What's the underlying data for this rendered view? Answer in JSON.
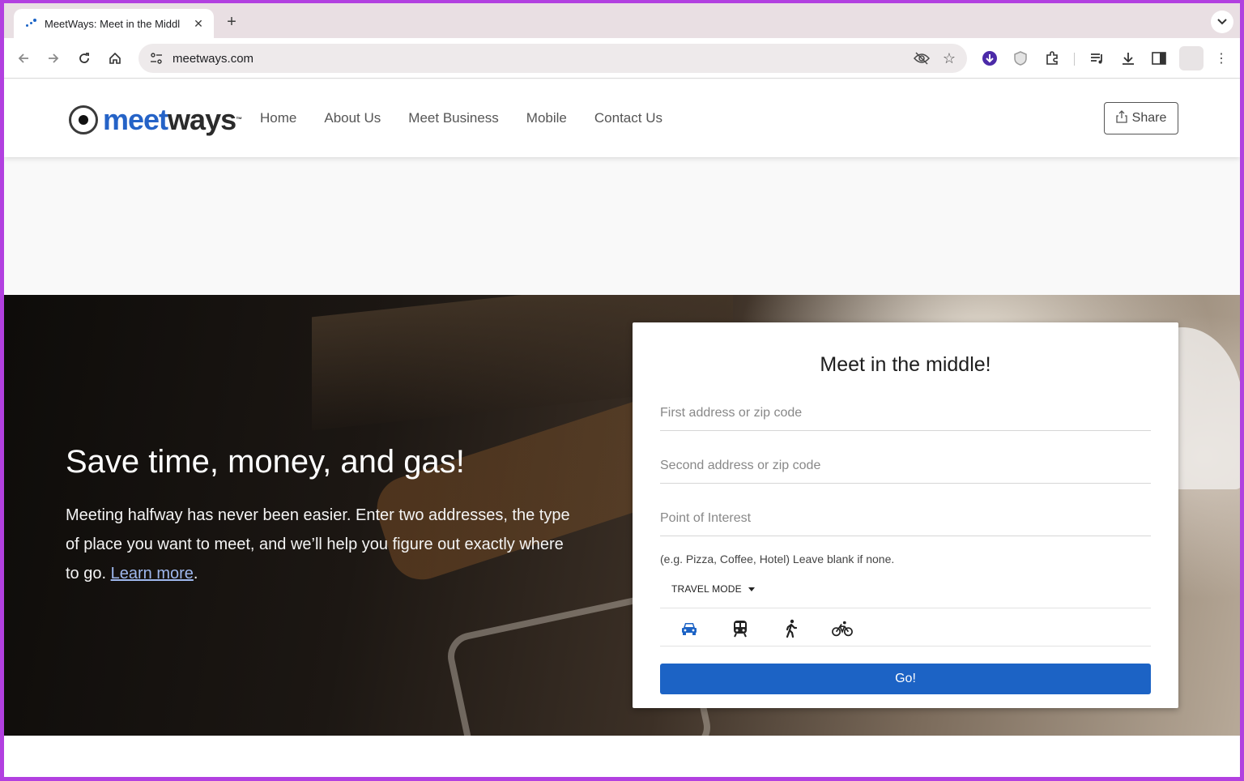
{
  "browser": {
    "tab_title": "MeetWays: Meet in the Middl",
    "new_tab_label": "+",
    "url": "meetways.com"
  },
  "site": {
    "logo": {
      "meet": "meet",
      "ways": "ways",
      "tm": "™"
    },
    "nav": [
      "Home",
      "About Us",
      "Meet Business",
      "Mobile",
      "Contact Us"
    ],
    "share_label": "Share"
  },
  "hero": {
    "title": "Save time, money, and gas!",
    "text": "Meeting halfway has never been easier. Enter two addresses, the type of place you want to meet, and we’ll help you figure out exactly where to go. ",
    "learn_more": "Learn more",
    "text_end": "."
  },
  "form": {
    "title": "Meet in the middle!",
    "first_placeholder": "First address or zip code",
    "second_placeholder": "Second address or zip code",
    "poi_placeholder": "Point of Interest",
    "hint": "(e.g. Pizza, Coffee, Hotel) Leave blank if none.",
    "travel_mode_label": "TRAVEL MODE",
    "modes": [
      "car-icon",
      "train-icon",
      "walk-icon",
      "bike-icon"
    ],
    "selected_mode": "car-icon",
    "go_label": "Go!"
  },
  "colors": {
    "brand_blue": "#1c63c5",
    "frame": "#b240e0"
  }
}
